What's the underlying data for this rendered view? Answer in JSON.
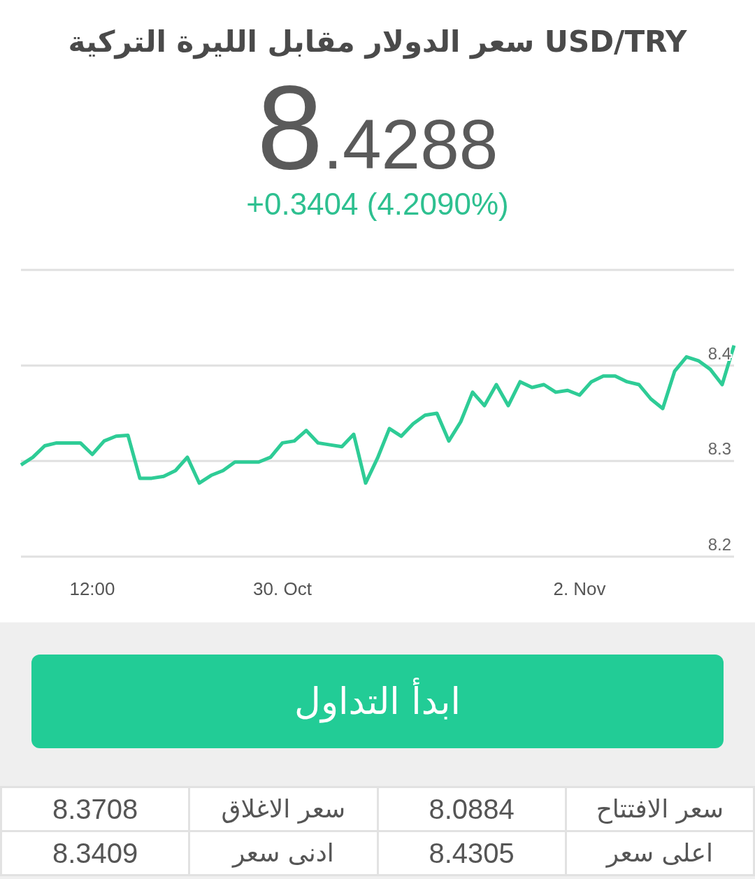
{
  "title": "سعر الدولار مقابل الليرة التركية USD/TRY",
  "price": {
    "integer": "8",
    "decimals": ".4288"
  },
  "change": {
    "text": "+0.3404 (4.2090%)"
  },
  "chart_data": {
    "type": "line",
    "categories": [
      null,
      null,
      null,
      null,
      null,
      null,
      "12:00",
      null,
      null,
      null,
      null,
      null,
      null,
      null,
      null,
      null,
      null,
      null,
      null,
      null,
      null,
      null,
      "30. Oct",
      null,
      null,
      null,
      null,
      null,
      null,
      null,
      null,
      null,
      null,
      null,
      null,
      null,
      null,
      null,
      null,
      null,
      null,
      null,
      null,
      null,
      null,
      null,
      null,
      "2. Nov",
      null,
      null,
      null,
      null,
      null,
      null,
      null,
      null,
      null,
      null,
      null,
      null,
      null
    ],
    "series": [
      {
        "color": "#2ecc96",
        "values": [
          8.296,
          8.304,
          8.316,
          8.319,
          8.319,
          8.319,
          8.307,
          8.321,
          8.326,
          8.327,
          8.282,
          8.282,
          8.284,
          8.29,
          8.304,
          8.277,
          8.285,
          8.29,
          8.299,
          8.299,
          8.299,
          8.304,
          8.319,
          8.321,
          8.332,
          8.319,
          8.317,
          8.315,
          8.328,
          8.277,
          8.303,
          8.334,
          8.326,
          8.339,
          8.348,
          8.35,
          8.321,
          8.341,
          8.372,
          8.358,
          8.38,
          8.358,
          8.383,
          8.377,
          8.38,
          8.372,
          8.374,
          8.369,
          8.383,
          8.389,
          8.389,
          8.383,
          8.38,
          8.365,
          8.355,
          8.394,
          8.409,
          8.405,
          8.396,
          8.38,
          8.421
        ]
      }
    ],
    "ylim": [
      8.2,
      8.5
    ],
    "yticks": [
      8.2,
      8.3,
      8.4
    ]
  },
  "trade_button": {
    "label": "ابدأ التداول"
  },
  "stats": [
    [
      {
        "label": "سعر الافتتاح",
        "value": "8.0884"
      },
      {
        "label": "سعر الاغلاق",
        "value": "8.3708"
      }
    ],
    [
      {
        "label": "اعلى سعر",
        "value": "8.4305"
      },
      {
        "label": "ادنى سعر",
        "value": "8.3409"
      }
    ]
  ]
}
